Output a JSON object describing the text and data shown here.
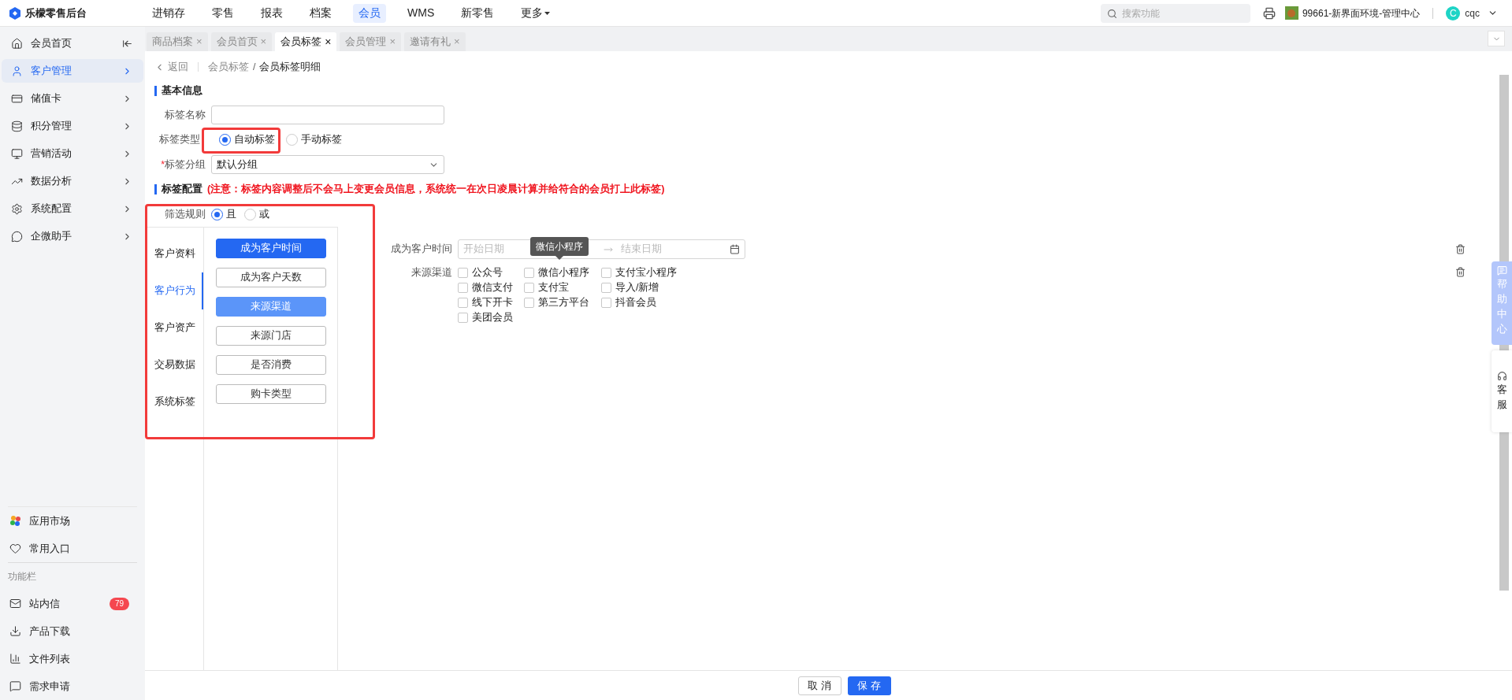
{
  "app": {
    "name": "乐檬零售后台"
  },
  "nav": [
    {
      "label": "进销存",
      "selected": false
    },
    {
      "label": "零售",
      "selected": false
    },
    {
      "label": "报表",
      "selected": false
    },
    {
      "label": "档案",
      "selected": false
    },
    {
      "label": "会员",
      "selected": true
    },
    {
      "label": "WMS",
      "selected": false
    },
    {
      "label": "新零售",
      "selected": false
    },
    {
      "label": "更多",
      "selected": false,
      "kind": "dropdown"
    }
  ],
  "header": {
    "search_placeholder": "搜索功能",
    "store": "99661-新界面环境-管理中心",
    "avatar_letter": "C",
    "user": "cqc"
  },
  "sidebar": {
    "items": [
      {
        "label": "会员首页",
        "selected": false,
        "kind": "collapse"
      },
      {
        "label": "客户管理",
        "selected": true,
        "kind": "chevron"
      },
      {
        "label": "储值卡",
        "selected": false,
        "kind": "chevron"
      },
      {
        "label": "积分管理",
        "selected": false,
        "kind": "chevron"
      },
      {
        "label": "营销活动",
        "selected": false,
        "kind": "chevron"
      },
      {
        "label": "数据分析",
        "selected": false,
        "kind": "chevron"
      },
      {
        "label": "系统配置",
        "selected": false,
        "kind": "chevron"
      },
      {
        "label": "企微助手",
        "selected": false,
        "kind": "chevron"
      }
    ],
    "bottom": [
      {
        "label": "应用市场"
      },
      {
        "label": "常用入口"
      }
    ],
    "section": "功能栏",
    "tools": [
      {
        "label": "站内信",
        "badge": "79"
      },
      {
        "label": "产品下载"
      },
      {
        "label": "文件列表"
      },
      {
        "label": "需求申请"
      }
    ]
  },
  "tabs": [
    {
      "label": "商品档案",
      "close": "×",
      "selected": false
    },
    {
      "label": "会员首页",
      "close": "×",
      "selected": false
    },
    {
      "label": "会员标签",
      "close": "×",
      "selected": true
    },
    {
      "label": "会员管理",
      "close": "×",
      "selected": false
    },
    {
      "label": "邀请有礼",
      "close": "×",
      "selected": false
    }
  ],
  "breadcrumb": {
    "back": "返回",
    "items": [
      "会员标签",
      "会员标签明细"
    ],
    "separator": "/"
  },
  "basic": {
    "title": "基本信息",
    "name_label": "标签名称",
    "type_label": "标签类型",
    "types": [
      {
        "label": "自动标签",
        "selected": true
      },
      {
        "label": "手动标签",
        "selected": false
      }
    ],
    "group_label": "标签分组",
    "required": "*",
    "group_value": "默认分组"
  },
  "config": {
    "title": "标签配置",
    "notice": "(注意：标签内容调整后不会马上变更会员信息，系统统一在次日凌晨计算并给符合的会员打上此标签)",
    "rule_label": "筛选规则",
    "rules": [
      {
        "label": "且",
        "selected": true
      },
      {
        "label": "或",
        "selected": false
      }
    ],
    "categories": [
      {
        "label": "客户资料",
        "selected": false
      },
      {
        "label": "客户行为",
        "selected": true
      },
      {
        "label": "客户资产",
        "selected": false
      },
      {
        "label": "交易数据",
        "selected": false
      },
      {
        "label": "系统标签",
        "selected": false
      }
    ],
    "conditions": [
      {
        "label": "成为客户时间",
        "selected": true,
        "added": true
      },
      {
        "label": "成为客户天数",
        "selected": false,
        "added": false
      },
      {
        "label": "来源渠道",
        "selected": false,
        "added": true
      },
      {
        "label": "来源门店",
        "selected": false,
        "added": false
      },
      {
        "label": "是否消费",
        "selected": false,
        "added": false
      },
      {
        "label": "购卡类型",
        "selected": false,
        "added": false
      }
    ],
    "date_row": {
      "label": "成为客户时间",
      "start_placeholder": "开始日期",
      "end_placeholder": "结束日期"
    },
    "tooltip": "微信小程序",
    "channel_row": {
      "label": "来源渠道",
      "options": [
        {
          "label": "公众号",
          "checked": false
        },
        {
          "label": "微信小程序",
          "checked": false
        },
        {
          "label": "支付宝小程序",
          "checked": false
        },
        {
          "label": "微信支付",
          "checked": false
        },
        {
          "label": "支付宝",
          "checked": false
        },
        {
          "label": "导入/新增",
          "checked": false
        },
        {
          "label": "线下开卡",
          "checked": false
        },
        {
          "label": "第三方平台",
          "checked": false
        },
        {
          "label": "抖音会员",
          "checked": false
        },
        {
          "label": "美团会员",
          "checked": false
        }
      ]
    }
  },
  "float": {
    "help": "帮助中心",
    "service": "客服"
  },
  "footer": {
    "cancel": "取 消",
    "save": "保 存"
  }
}
